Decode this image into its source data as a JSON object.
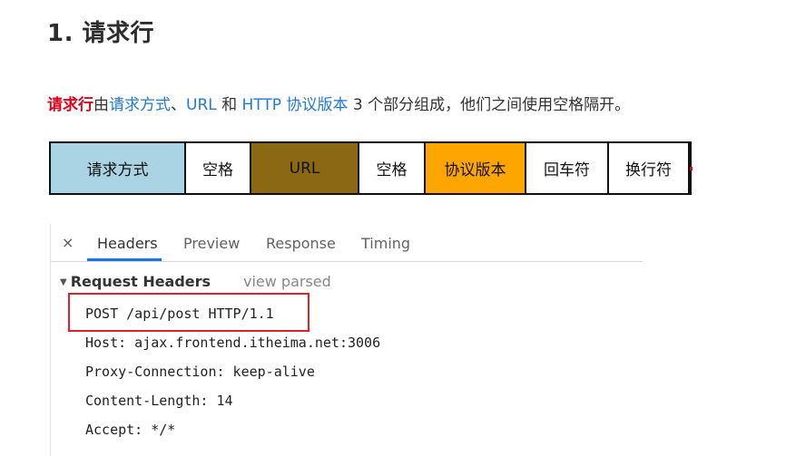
{
  "heading": "1. 请求行",
  "paragraph": {
    "lead": "请求行",
    "t1": "由",
    "method": "请求方式",
    "t2": "、",
    "url": "URL",
    "t3": " 和 ",
    "http": "HTTP 协议版本",
    "t4": " 3 个部分组成，他们之间使用空格隔开。"
  },
  "diagram": {
    "cells": [
      {
        "label": "请求方式",
        "color": "#aad4e4"
      },
      {
        "label": "空格",
        "color": "#ffffff"
      },
      {
        "label": "URL",
        "color": "#8b6914"
      },
      {
        "label": "空格",
        "color": "#ffffff"
      },
      {
        "label": "协议版本",
        "color": "#ffa500"
      },
      {
        "label": "回车符",
        "color": "#ffffff"
      },
      {
        "label": "换行符",
        "color": "#ffffff"
      }
    ]
  },
  "devtools": {
    "close_icon": "×",
    "tabs": [
      "Headers",
      "Preview",
      "Response",
      "Timing"
    ],
    "active_tab": "Headers",
    "section_title": "Request Headers",
    "view_parsed": "view parsed",
    "headers": [
      "POST /api/post HTTP/1.1",
      "Host: ajax.frontend.itheima.net:3006",
      "Proxy-Connection: keep-alive",
      "Content-Length: 14",
      "Accept: */*"
    ],
    "highlight_color": "#d6262b",
    "accent": "#1a73e8"
  }
}
